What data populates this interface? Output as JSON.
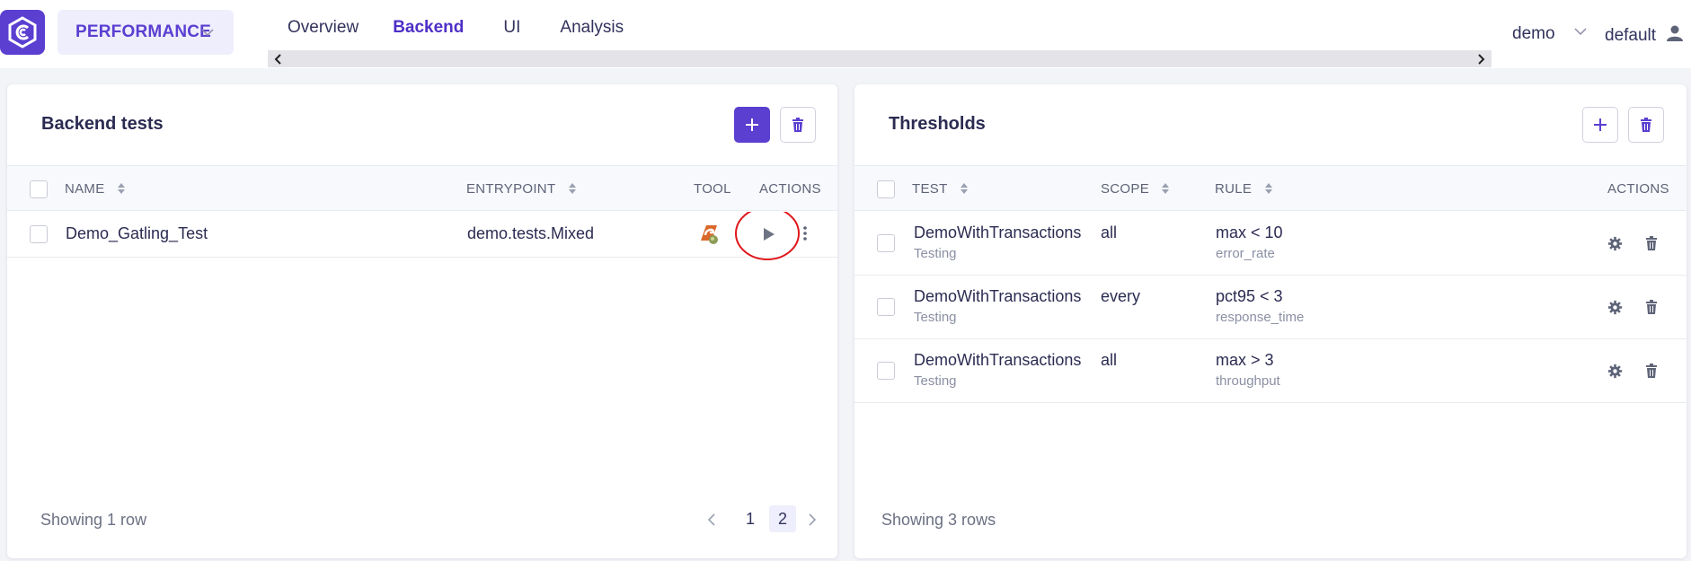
{
  "header": {
    "module": "PERFORMANCE",
    "tabs": [
      {
        "label": "Overview",
        "active": false
      },
      {
        "label": "Backend",
        "active": true
      },
      {
        "label": "UI",
        "active": false
      },
      {
        "label": "Analysis",
        "active": false
      }
    ],
    "project": "demo",
    "user": "default"
  },
  "backend": {
    "title": "Backend tests",
    "columns": {
      "name": "NAME",
      "entrypoint": "ENTRYPOINT",
      "tool": "TOOL",
      "actions": "ACTIONS"
    },
    "rows": [
      {
        "name": "Demo_Gatling_Test",
        "entrypoint": "demo.tests.Mixed",
        "tool_icon": "gatling-icon"
      }
    ],
    "footer": "Showing 1 row",
    "pagination": {
      "pages": [
        "1",
        "2"
      ],
      "current": "2"
    }
  },
  "thresholds": {
    "title": "Thresholds",
    "columns": {
      "test": "TEST",
      "scope": "SCOPE",
      "rule": "RULE",
      "actions": "ACTIONS"
    },
    "rows": [
      {
        "test": "DemoWithTransactions",
        "env": "Testing",
        "scope": "all",
        "rule": "max < 10",
        "target": "error_rate"
      },
      {
        "test": "DemoWithTransactions",
        "env": "Testing",
        "scope": "every",
        "rule": "pct95 < 3",
        "target": "response_time"
      },
      {
        "test": "DemoWithTransactions",
        "env": "Testing",
        "scope": "all",
        "rule": "max > 3",
        "target": "throughput"
      }
    ],
    "footer": "Showing 3 rows"
  },
  "colors": {
    "accent": "#5b3fd1",
    "highlight": "#e0161b"
  }
}
